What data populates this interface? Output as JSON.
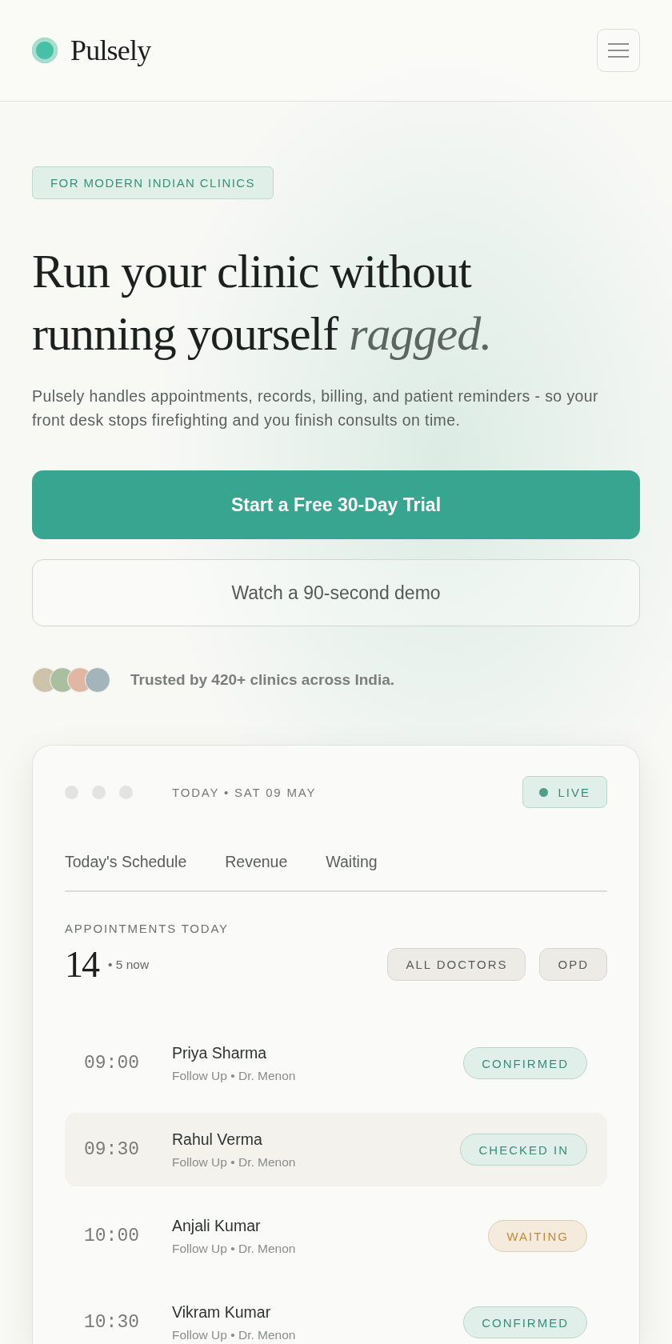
{
  "header": {
    "brand": "Pulsely"
  },
  "hero": {
    "eyebrow": "FOR MODERN INDIAN CLINICS",
    "headline": "Run your clinic without running yourself *ragged.*",
    "description": "Pulsely handles appointments, records, billing, and patient reminders - so your front desk stops firefighting and you finish consults on time.",
    "primary_button": "Start a Free 30-Day Trial",
    "secondary_button": "Watch a 90-second demo",
    "trust": {
      "avatars": [
        {
          "color": "#cdc3ab"
        },
        {
          "color": "#a9bf9f"
        },
        {
          "color": "#dfb7a3"
        },
        {
          "color": "#a3b4bb"
        }
      ],
      "text": "Trusted by 420+ clinics across India."
    }
  },
  "dashboard": {
    "date": "TODAY • SAT 09 MAY",
    "status": "LIVE",
    "tabs": [
      {
        "label": "Today's Schedule"
      },
      {
        "label": "Revenue"
      },
      {
        "label": "Waiting"
      }
    ],
    "summary": {
      "label": "APPOINTMENTS TODAY",
      "count": "14",
      "now": "• 5 now"
    },
    "filters": [
      "ALL DOCTORS",
      "OPD"
    ],
    "appointments": [
      {
        "time": "09:00",
        "name": "Priya Sharma",
        "details": "Follow Up • Dr. Menon",
        "status": "CONFIRMED",
        "kind": "confirmed",
        "selected": false
      },
      {
        "time": "09:30",
        "name": "Rahul Verma",
        "details": "Follow Up • Dr. Menon",
        "status": "CHECKED IN",
        "kind": "checked-in",
        "selected": true
      },
      {
        "time": "10:00",
        "name": "Anjali Kumar",
        "details": "Follow Up • Dr. Menon",
        "status": "WAITING",
        "kind": "waiting",
        "selected": false
      },
      {
        "time": "10:30",
        "name": "Vikram Kumar",
        "details": "Follow Up • Dr. Menon",
        "status": "CONFIRMED",
        "kind": "confirmed",
        "selected": false
      }
    ]
  }
}
